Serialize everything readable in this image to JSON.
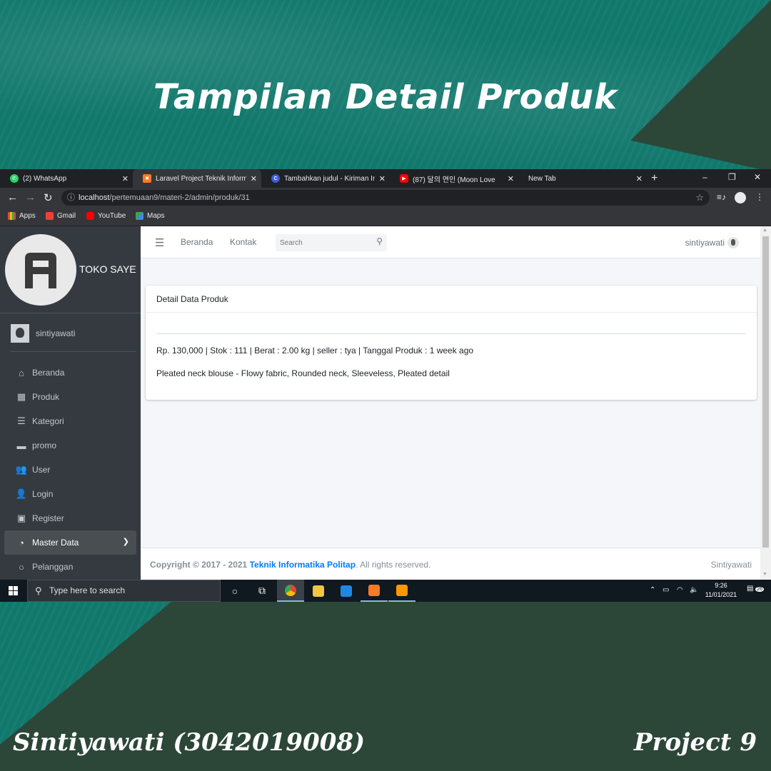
{
  "poster": {
    "title": "Tampilan Detail Produk",
    "author": "Sintiyawati (3042019008)",
    "project": "Project 9"
  },
  "browser": {
    "tabs": [
      {
        "label": "(2) WhatsApp",
        "icon": "whatsapp-icon",
        "color": "#25d366",
        "active": false
      },
      {
        "label": "Laravel Project Teknik Informat",
        "icon": "xampp-icon",
        "color": "#fb7a24",
        "active": true
      },
      {
        "label": "Tambahkan judul - Kiriman Ins",
        "icon": "canva-icon",
        "color": "#3b5bdb",
        "active": false
      },
      {
        "label": "(87) 달의 연인 (Moon Love",
        "icon": "youtube-icon",
        "color": "#ff0000",
        "active": false
      },
      {
        "label": "New Tab",
        "icon": "",
        "color": "",
        "active": false
      }
    ],
    "url_host": "localhost",
    "url_path": "/pertemuaan9/materi-2/admin/produk/31",
    "bookmarks": [
      "Apps",
      "Gmail",
      "YouTube",
      "Maps"
    ]
  },
  "sidebar": {
    "brand_letter": "A",
    "brand_name": "TOKO SAYE",
    "user_name": "sintiyawati",
    "items": [
      {
        "label": "Beranda",
        "icon": "home-icon"
      },
      {
        "label": "Produk",
        "icon": "grid-icon"
      },
      {
        "label": "Kategori",
        "icon": "list-icon"
      },
      {
        "label": "promo",
        "icon": "wallet-icon"
      },
      {
        "label": "User",
        "icon": "users-icon"
      },
      {
        "label": "Login",
        "icon": "user-icon"
      },
      {
        "label": "Register",
        "icon": "address-book-icon"
      },
      {
        "label": "Master Data",
        "icon": "dashboard-icon",
        "active": true
      },
      {
        "label": "Pelanggan",
        "icon": "circle-icon"
      }
    ]
  },
  "topnav": {
    "links": [
      "Beranda",
      "Kontak"
    ],
    "search_placeholder": "Search",
    "user": "sintiyawati"
  },
  "card": {
    "title": "Detail Data Produk",
    "meta": "Rp. 130,000 | Stok : 111 | Berat : 2.00 kg | seller : tya | Tanggal Produk : 1 week ago",
    "description": "Pleated neck blouse - Flowy fabric, Rounded neck, Sleeveless, Pleated detail"
  },
  "footer": {
    "copyright_prefix": "Copyright © 2017 - 2021",
    "org": "Teknik Informatika Politap",
    "suffix": ". All rights reserved.",
    "right": "Sintiyawati"
  },
  "taskbar": {
    "search_placeholder": "Type here to search",
    "time": "9:26",
    "date": "11/01/2021",
    "notification_count": "26"
  },
  "colors": {
    "sidebar_bg": "#343a40",
    "accent_link": "#007bff",
    "poster_teal": "#11786c",
    "poster_dark": "#2c4638"
  }
}
